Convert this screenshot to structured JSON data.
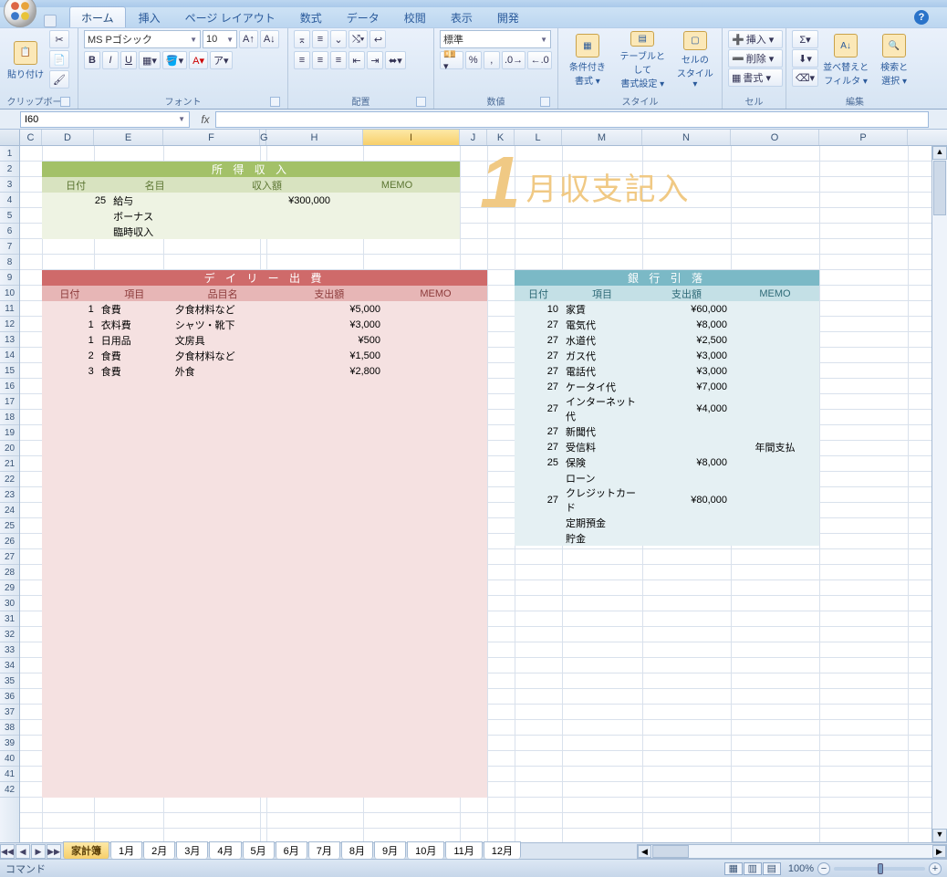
{
  "tabs": [
    "ホーム",
    "挿入",
    "ページ レイアウト",
    "数式",
    "データ",
    "校閲",
    "表示",
    "開発"
  ],
  "active_tab": 0,
  "help": "?",
  "ribbon": {
    "clipboard": {
      "paste": "貼り付け",
      "label": "クリップボード"
    },
    "font": {
      "name": "MS Pゴシック",
      "size": "10",
      "label": "フォント"
    },
    "align": {
      "label": "配置"
    },
    "number": {
      "style": "標準",
      "label": "数値"
    },
    "styles": {
      "cond": "条件付き\n書式 ▾",
      "table": "テーブルとして\n書式設定 ▾",
      "cell": "セルの\nスタイル ▾",
      "label": "スタイル"
    },
    "cells": {
      "insert": "挿入 ▾",
      "delete": "削除 ▾",
      "format": "書式 ▾",
      "label": "セル"
    },
    "editing": {
      "sort": "並べ替えと\nフィルタ ▾",
      "find": "検索と\n選択 ▾",
      "label": "編集"
    }
  },
  "namebox": "I60",
  "fx": "fx",
  "formula": "",
  "columns": [
    {
      "l": "C",
      "w": 24
    },
    {
      "l": "D",
      "w": 57
    },
    {
      "l": "E",
      "w": 76
    },
    {
      "l": "F",
      "w": 106
    },
    {
      "l": "G",
      "w": 7
    },
    {
      "l": "H",
      "w": 106
    },
    {
      "l": "I",
      "w": 106
    },
    {
      "l": "J",
      "w": 30
    },
    {
      "l": "K",
      "w": 30
    },
    {
      "l": "L",
      "w": 52
    },
    {
      "l": "M",
      "w": 88
    },
    {
      "l": "N",
      "w": 97
    },
    {
      "l": "O",
      "w": 97
    },
    {
      "l": "P",
      "w": 97
    }
  ],
  "sel_col": "I",
  "rows_count": 42,
  "active_cell": {
    "c": "I",
    "r": 60
  },
  "title_art": {
    "num": "1",
    "txt": "月収支記入"
  },
  "income": {
    "title": "所 得 収 入",
    "headers": [
      "日付",
      "名目",
      "収入額",
      "MEMO"
    ],
    "rows": [
      {
        "d": "25",
        "n": "給与",
        "a": "¥300,000",
        "m": ""
      },
      {
        "d": "",
        "n": "ボーナス",
        "a": "",
        "m": ""
      },
      {
        "d": "",
        "n": "臨時収入",
        "a": "",
        "m": ""
      }
    ]
  },
  "daily": {
    "title": "デ イ リ ー 出 費",
    "headers": [
      "日付",
      "項目",
      "品目名",
      "支出額",
      "MEMO"
    ],
    "rows": [
      {
        "d": "1",
        "c": "食費",
        "i": "夕食材料など",
        "a": "¥5,000",
        "m": ""
      },
      {
        "d": "1",
        "c": "衣料費",
        "i": "シャツ・靴下",
        "a": "¥3,000",
        "m": ""
      },
      {
        "d": "1",
        "c": "日用品",
        "i": "文房具",
        "a": "¥500",
        "m": ""
      },
      {
        "d": "2",
        "c": "食費",
        "i": "夕食材料など",
        "a": "¥1,500",
        "m": ""
      },
      {
        "d": "3",
        "c": "食費",
        "i": "外食",
        "a": "¥2,800",
        "m": ""
      }
    ],
    "empty_rows": 27
  },
  "bank": {
    "title": "銀 行 引 落",
    "headers": [
      "日付",
      "項目",
      "支出額",
      "MEMO"
    ],
    "rows": [
      {
        "d": "10",
        "c": "家賃",
        "a": "¥60,000",
        "m": ""
      },
      {
        "d": "27",
        "c": "電気代",
        "a": "¥8,000",
        "m": ""
      },
      {
        "d": "27",
        "c": "水道代",
        "a": "¥2,500",
        "m": ""
      },
      {
        "d": "27",
        "c": "ガス代",
        "a": "¥3,000",
        "m": ""
      },
      {
        "d": "27",
        "c": "電話代",
        "a": "¥3,000",
        "m": ""
      },
      {
        "d": "27",
        "c": "ケータイ代",
        "a": "¥7,000",
        "m": ""
      },
      {
        "d": "27",
        "c": "インターネット代",
        "a": "¥4,000",
        "m": ""
      },
      {
        "d": "27",
        "c": "新聞代",
        "a": "",
        "m": ""
      },
      {
        "d": "27",
        "c": "受信料",
        "a": "",
        "m": "年間支払"
      },
      {
        "d": "25",
        "c": "保険",
        "a": "¥8,000",
        "m": ""
      },
      {
        "d": "",
        "c": "ローン",
        "a": "",
        "m": ""
      },
      {
        "d": "27",
        "c": "クレジットカード",
        "a": "¥80,000",
        "m": ""
      },
      {
        "d": "",
        "c": "定期預金",
        "a": "",
        "m": ""
      },
      {
        "d": "",
        "c": "貯金",
        "a": "",
        "m": ""
      }
    ]
  },
  "sheet_tabs": [
    "家計簿",
    "1月",
    "2月",
    "3月",
    "4月",
    "5月",
    "6月",
    "7月",
    "8月",
    "9月",
    "10月",
    "11月",
    "12月"
  ],
  "active_sheet": 0,
  "status": "コマンド",
  "zoom": "100%"
}
